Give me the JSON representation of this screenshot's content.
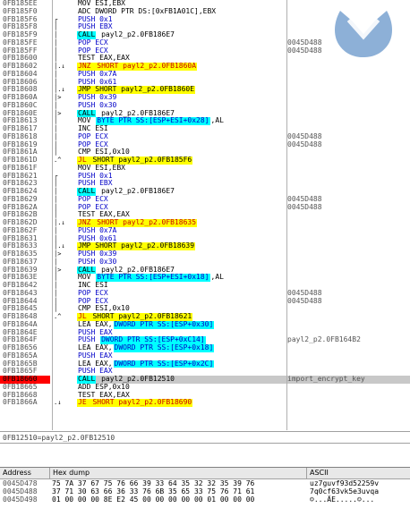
{
  "disasm": [
    {
      "addr": "0FB185EE",
      "gut": "",
      "parts": [
        [
          "n",
          "MOV ESI,EBX"
        ]
      ],
      "cmt": ""
    },
    {
      "addr": "0FB185F0",
      "gut": "",
      "parts": [
        [
          "n",
          "ADC DWORD PTR DS:[0xFB1A01C],EBX"
        ]
      ],
      "cmt": ""
    },
    {
      "addr": "0FB185F6",
      "gut": "r",
      "parts": [
        [
          "push",
          "PUSH 0x1"
        ]
      ],
      "cmt": ""
    },
    {
      "addr": "0FB185F8",
      "gut": "|",
      "parts": [
        [
          "push",
          "PUSH EBX"
        ]
      ],
      "cmt": ""
    },
    {
      "addr": "0FB185F9",
      "gut": "|",
      "parts": [
        [
          "call",
          "CALL"
        ],
        [
          "n",
          " payl2_p2.0FB186E7"
        ]
      ],
      "cmt": ""
    },
    {
      "addr": "0FB185FE",
      "gut": "|",
      "parts": [
        [
          "pop",
          "POP ECX"
        ]
      ],
      "cmt": "0045D488"
    },
    {
      "addr": "0FB185FF",
      "gut": "|",
      "parts": [
        [
          "pop",
          "POP ECX"
        ]
      ],
      "cmt": "0045D488"
    },
    {
      "addr": "0FB18600",
      "gut": "|",
      "parts": [
        [
          "n",
          "TEST EAX,EAX"
        ]
      ],
      "cmt": ""
    },
    {
      "addr": "0FB18602",
      "gut": "|.v",
      "parts": [
        [
          "jcc",
          "JNZ"
        ],
        [
          "jcc",
          " SHORT payl2_p2.0FB1860A"
        ]
      ],
      "cmt": ""
    },
    {
      "addr": "0FB18604",
      "gut": "|",
      "parts": [
        [
          "push",
          "PUSH 0x7A"
        ]
      ],
      "cmt": ""
    },
    {
      "addr": "0FB18606",
      "gut": "|",
      "parts": [
        [
          "push",
          "PUSH 0x61"
        ]
      ],
      "cmt": ""
    },
    {
      "addr": "0FB18608",
      "gut": "|.v",
      "parts": [
        [
          "jmp",
          "JMP SHORT payl2_p2.0FB1860E"
        ]
      ],
      "cmt": ""
    },
    {
      "addr": "0FB1860A",
      "gut": "|>",
      "parts": [
        [
          "push",
          "PUSH 0x39"
        ]
      ],
      "cmt": ""
    },
    {
      "addr": "0FB1860C",
      "gut": "|",
      "parts": [
        [
          "push",
          "PUSH 0x30"
        ]
      ],
      "cmt": ""
    },
    {
      "addr": "0FB1860E",
      "gut": "|>",
      "parts": [
        [
          "call",
          "CALL"
        ],
        [
          "n",
          " payl2_p2.0FB186E7"
        ]
      ],
      "cmt": ""
    },
    {
      "addr": "0FB18613",
      "gut": "|",
      "parts": [
        [
          "n",
          "MOV "
        ],
        [
          "ptr",
          "BYTE PTR SS:[ESP+ESI+0x28]"
        ],
        [
          "n",
          ",AL"
        ]
      ],
      "cmt": ""
    },
    {
      "addr": "0FB18617",
      "gut": "|",
      "parts": [
        [
          "n",
          "INC ESI"
        ]
      ],
      "cmt": ""
    },
    {
      "addr": "0FB18618",
      "gut": "|",
      "parts": [
        [
          "pop",
          "POP ECX"
        ]
      ],
      "cmt": "0045D488"
    },
    {
      "addr": "0FB18619",
      "gut": "|",
      "parts": [
        [
          "pop",
          "POP ECX"
        ]
      ],
      "cmt": "0045D488"
    },
    {
      "addr": "0FB1861A",
      "gut": "|",
      "parts": [
        [
          "n",
          "CMP ESI,0x10"
        ]
      ],
      "cmt": ""
    },
    {
      "addr": "0FB1861D",
      "gut": "^",
      "parts": [
        [
          "jcc",
          "JL"
        ],
        [
          "jmp",
          " SHORT payl2_p2.0FB185F6"
        ]
      ],
      "cmt": ""
    },
    {
      "addr": "0FB1861F",
      "gut": "",
      "parts": [
        [
          "n",
          "MOV ESI,EBX"
        ]
      ],
      "cmt": ""
    },
    {
      "addr": "0FB18621",
      "gut": "r",
      "parts": [
        [
          "push",
          "PUSH 0x1"
        ]
      ],
      "cmt": ""
    },
    {
      "addr": "0FB18623",
      "gut": "|",
      "parts": [
        [
          "push",
          "PUSH EBX"
        ]
      ],
      "cmt": ""
    },
    {
      "addr": "0FB18624",
      "gut": "|",
      "parts": [
        [
          "call",
          "CALL"
        ],
        [
          "n",
          " payl2_p2.0FB186E7"
        ]
      ],
      "cmt": ""
    },
    {
      "addr": "0FB18629",
      "gut": "|",
      "parts": [
        [
          "pop",
          "POP ECX"
        ]
      ],
      "cmt": "0045D488"
    },
    {
      "addr": "0FB1862A",
      "gut": "|",
      "parts": [
        [
          "pop",
          "POP ECX"
        ]
      ],
      "cmt": "0045D488"
    },
    {
      "addr": "0FB1862B",
      "gut": "|",
      "parts": [
        [
          "n",
          "TEST EAX,EAX"
        ]
      ],
      "cmt": ""
    },
    {
      "addr": "0FB1862D",
      "gut": "|.v",
      "parts": [
        [
          "jcc",
          "JNZ"
        ],
        [
          "jcc",
          " SHORT payl2_p2.0FB18635"
        ]
      ],
      "cmt": ""
    },
    {
      "addr": "0FB1862F",
      "gut": "|",
      "parts": [
        [
          "push",
          "PUSH 0x7A"
        ]
      ],
      "cmt": ""
    },
    {
      "addr": "0FB18631",
      "gut": "|",
      "parts": [
        [
          "push",
          "PUSH 0x61"
        ]
      ],
      "cmt": ""
    },
    {
      "addr": "0FB18633",
      "gut": "|.v",
      "parts": [
        [
          "jmp",
          "JMP SHORT payl2_p2.0FB18639"
        ]
      ],
      "cmt": ""
    },
    {
      "addr": "0FB18635",
      "gut": "|>",
      "parts": [
        [
          "push",
          "PUSH 0x39"
        ]
      ],
      "cmt": ""
    },
    {
      "addr": "0FB18637",
      "gut": "|",
      "parts": [
        [
          "push",
          "PUSH 0x30"
        ]
      ],
      "cmt": ""
    },
    {
      "addr": "0FB18639",
      "gut": "|>",
      "parts": [
        [
          "call",
          "CALL"
        ],
        [
          "n",
          " payl2_p2.0FB186E7"
        ]
      ],
      "cmt": ""
    },
    {
      "addr": "0FB1863E",
      "gut": "|",
      "parts": [
        [
          "n",
          "MOV "
        ],
        [
          "ptr",
          "BYTE PTR SS:[ESP+ESI+0x18]"
        ],
        [
          "n",
          ",AL"
        ]
      ],
      "cmt": ""
    },
    {
      "addr": "0FB18642",
      "gut": "|",
      "parts": [
        [
          "n",
          "INC ESI"
        ]
      ],
      "cmt": ""
    },
    {
      "addr": "0FB18643",
      "gut": "|",
      "parts": [
        [
          "pop",
          "POP ECX"
        ]
      ],
      "cmt": "0045D488"
    },
    {
      "addr": "0FB18644",
      "gut": "|",
      "parts": [
        [
          "pop",
          "POP ECX"
        ]
      ],
      "cmt": "0045D488"
    },
    {
      "addr": "0FB18645",
      "gut": "|",
      "parts": [
        [
          "n",
          "CMP ESI,0x10"
        ]
      ],
      "cmt": ""
    },
    {
      "addr": "0FB18648",
      "gut": "^",
      "parts": [
        [
          "jcc",
          "JL"
        ],
        [
          "jmp",
          " SHORT payl2_p2.0FB18621"
        ]
      ],
      "cmt": ""
    },
    {
      "addr": "0FB1864A",
      "gut": "",
      "parts": [
        [
          "n",
          "LEA EAX,"
        ],
        [
          "ptr",
          "DWORD PTR SS:[ESP+0x30]"
        ]
      ],
      "cmt": ""
    },
    {
      "addr": "0FB1864E",
      "gut": "",
      "parts": [
        [
          "push",
          "PUSH EAX"
        ]
      ],
      "cmt": ""
    },
    {
      "addr": "0FB1864F",
      "gut": "",
      "parts": [
        [
          "push",
          "PUSH "
        ],
        [
          "ptr",
          "DWORD PTR SS:[ESP+0xC14]"
        ]
      ],
      "cmt": "payl2_p2.0FB164B2"
    },
    {
      "addr": "0FB18656",
      "gut": "",
      "parts": [
        [
          "n",
          "LEA EAX,"
        ],
        [
          "ptr",
          "DWORD PTR SS:[ESP+0x18]"
        ]
      ],
      "cmt": ""
    },
    {
      "addr": "0FB1865A",
      "gut": "",
      "parts": [
        [
          "push",
          "PUSH EAX"
        ]
      ],
      "cmt": ""
    },
    {
      "addr": "0FB1865B",
      "gut": "",
      "parts": [
        [
          "n",
          "LEA EAX,"
        ],
        [
          "ptr",
          "DWORD PTR SS:[ESP+0x2C]"
        ]
      ],
      "cmt": ""
    },
    {
      "addr": "0FB1865F",
      "gut": "",
      "parts": [
        [
          "push",
          "PUSH EAX"
        ]
      ],
      "cmt": ""
    },
    {
      "addr": "0FB18660",
      "gut": "",
      "parts": [
        [
          "call",
          "CALL"
        ],
        [
          "n",
          " payl2_p2.0FB12510"
        ]
      ],
      "cmt": "import_encrypt_key",
      "sel": true
    },
    {
      "addr": "0FB18665",
      "gut": "",
      "parts": [
        [
          "n",
          "ADD ESP,0x10"
        ]
      ],
      "cmt": ""
    },
    {
      "addr": "0FB18668",
      "gut": "",
      "parts": [
        [
          "n",
          "TEST EAX,EAX"
        ]
      ],
      "cmt": ""
    },
    {
      "addr": "0FB1866A",
      "gut": ".v",
      "parts": [
        [
          "jcc",
          "JE"
        ],
        [
          "jcc",
          " SHORT payl2_p2.0FB18690"
        ]
      ],
      "cmt": ""
    }
  ],
  "info_text": "0FB12510=payl2_p2.0FB12510",
  "dump": {
    "headers": {
      "address": "Address",
      "hex": "Hex dump",
      "ascii": "ASCII"
    },
    "rows": [
      {
        "addr": "0045D478",
        "hex": "75 7A 37 67 75 76 66 39 33 64 35 32 32 35 39 76",
        "ascii": "uz7guvf93d52259v"
      },
      {
        "addr": "0045D488",
        "hex": "37 71 30 63 66 36 33 76 6B 35 65 33 75 76 71 61",
        "ascii": "7q0cf63vk5e3uvqa"
      },
      {
        "addr": "0045D498",
        "hex": "01 00 00 00 8E E2 45 00 00 00 00 00 01 00 00 00",
        "ascii": "☺...ÄE.....☺..."
      }
    ]
  },
  "logo": {
    "name": "malwarebytes-logo"
  }
}
